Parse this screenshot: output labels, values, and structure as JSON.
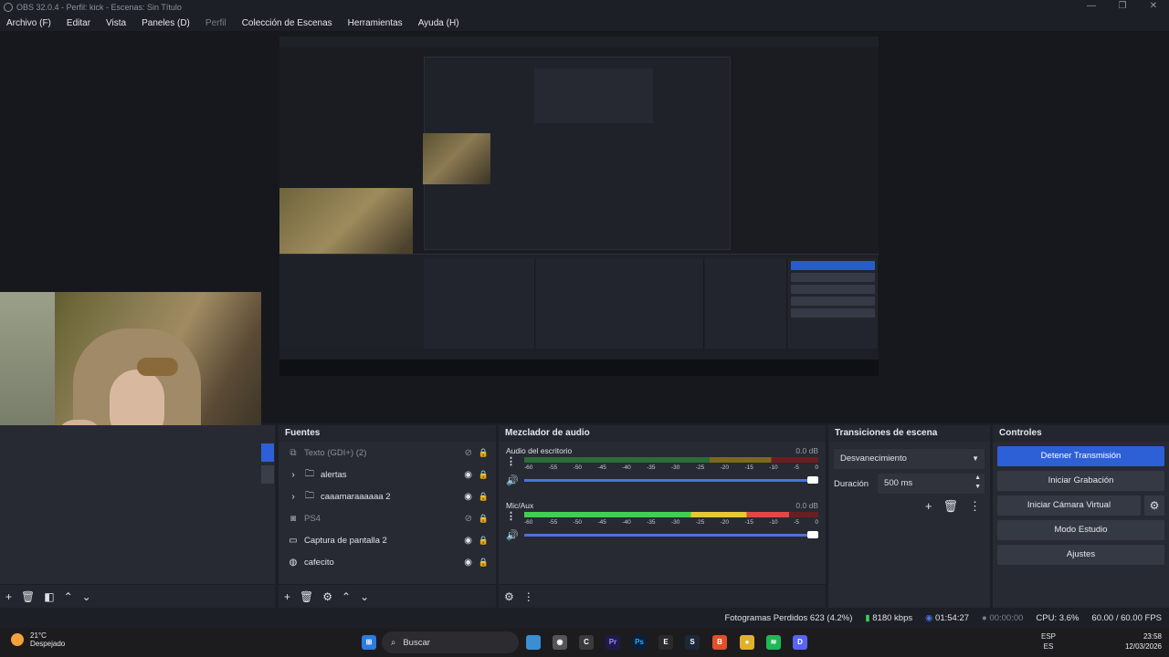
{
  "window": {
    "title": "OBS 32.0.4 - Perfil: kick - Escenas: Sin Título",
    "controls": [
      "—",
      "❐",
      "✕"
    ]
  },
  "menu": {
    "items": [
      "Archivo (F)",
      "Editar",
      "Vista",
      "Paneles (D)",
      "Perfil",
      "Colección de Escenas",
      "Herramientas",
      "Ayuda (H)"
    ]
  },
  "sources": {
    "title": "Fuentes",
    "items": [
      {
        "label": "Texto (GDI+) (2)",
        "icon": "text-icon",
        "expandable": false,
        "visible": false
      },
      {
        "label": "alertas",
        "icon": "folder-icon",
        "expandable": true,
        "visible": true
      },
      {
        "label": "caaamaraaaaaa 2",
        "icon": "folder-icon",
        "expandable": true,
        "visible": true
      },
      {
        "label": "PS4",
        "icon": "camera-icon",
        "expandable": false,
        "visible": false
      },
      {
        "label": "Captura de pantalla 2",
        "icon": "monitor-icon",
        "expandable": false,
        "visible": true
      },
      {
        "label": "cafecito",
        "icon": "globe-icon",
        "expandable": false,
        "visible": true
      }
    ]
  },
  "mixer": {
    "title": "Mezclador de audio",
    "ticks": [
      "-60",
      "-55",
      "-50",
      "-45",
      "-40",
      "-35",
      "-30",
      "-25",
      "-20",
      "-15",
      "-10",
      "-5",
      "0"
    ],
    "channels": [
      {
        "name": "Audio del escritorio",
        "db": "0.0 dB",
        "level": 0.0
      },
      {
        "name": "Mic/Aux",
        "db": "0.0 dB",
        "level": 0.9
      }
    ]
  },
  "transitions": {
    "title": "Transiciones de escena",
    "selected": "Desvanecimiento",
    "duration_label": "Duración",
    "duration_value": "500 ms"
  },
  "controls": {
    "title": "Controles",
    "stop_stream": "Detener Transmisión",
    "start_recording": "Iniciar Grabación",
    "start_virtual_cam": "Iniciar Cámara Virtual",
    "studio_mode": "Modo Estudio",
    "settings": "Ajustes"
  },
  "status": {
    "dropped_frames": "Fotogramas Perdidos 623 (4.2%)",
    "bitrate": "8180 kbps",
    "stream_time": "01:54:27",
    "rec_time": "00:00:00",
    "cpu": "CPU: 3.6%",
    "fps": "60.00 / 60.00 FPS"
  },
  "taskbar": {
    "temperature": "21°C",
    "weather": "Despejado",
    "search_placeholder": "Buscar",
    "lang_top": "ESP",
    "lang_bottom": "ES",
    "time": "23:58",
    "date": "12/03/2026"
  },
  "colors": {
    "accent": "#2d5fd6",
    "panel": "#272a33",
    "background": "#1d1f26"
  }
}
